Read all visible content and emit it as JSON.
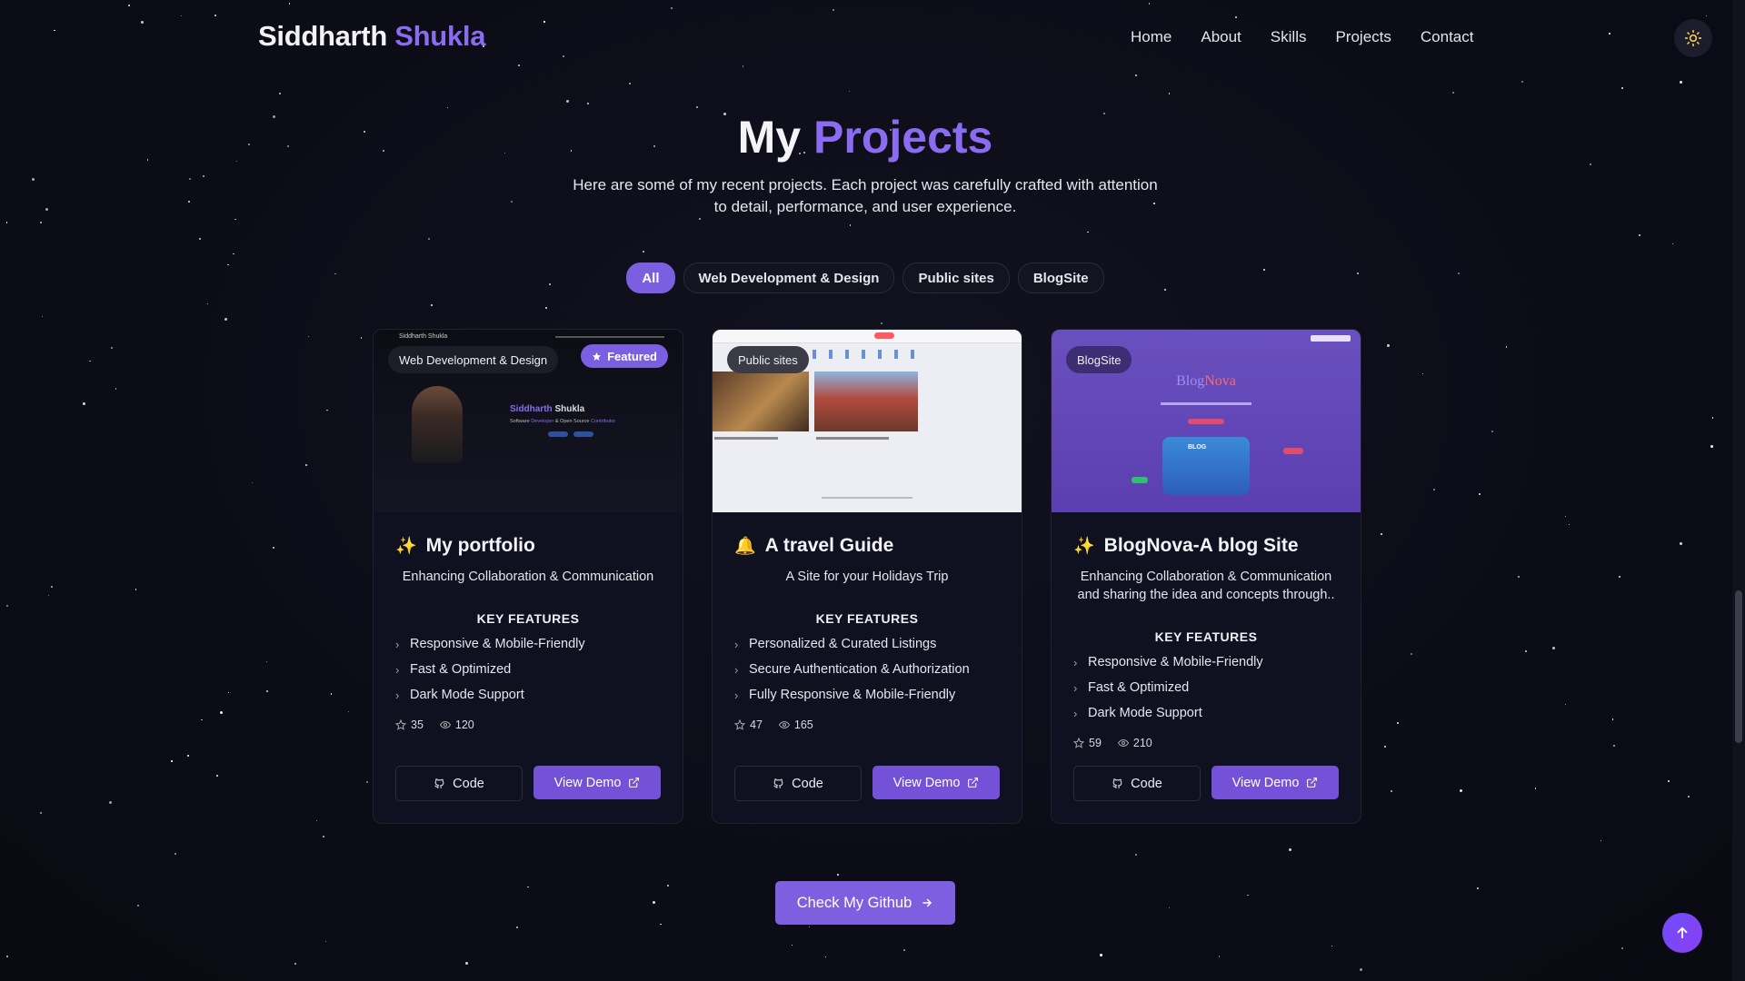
{
  "header": {
    "brand_first": "Siddharth",
    "brand_second": "Shukla",
    "nav": [
      "Home",
      "About",
      "Skills",
      "Projects",
      "Contact"
    ],
    "theme_icon": "sun-icon"
  },
  "section": {
    "title_first": "My",
    "title_second": "Projects",
    "subtitle": "Here are some of my recent projects. Each project was carefully crafted with attention to detail, performance, and user experience."
  },
  "filters": [
    "All",
    "Web Development & Design",
    "Public sites",
    "BlogSite"
  ],
  "active_filter": "All",
  "cards": [
    {
      "category": "Web Development & Design",
      "featured_label": "Featured",
      "emoji": "✨",
      "title": "My portfolio",
      "description": "Enhancing Collaboration & Communication",
      "key_features_label": "KEY FEATURES",
      "features": [
        "Responsive & Mobile-Friendly",
        "Fast & Optimized",
        "Dark Mode Support"
      ],
      "stars": "35",
      "views": "120",
      "code_label": "Code",
      "demo_label": "View Demo",
      "preview": {
        "nav_name": "Siddharth Shukla",
        "hero_first": "Siddharth",
        "hero_second": "Shukla",
        "tagline_start": "Software",
        "tagline_dev": "Developer",
        "tagline_mid": "& Open Source",
        "tagline_end": "Contributor"
      }
    },
    {
      "category": "Public sites",
      "emoji": "🔔",
      "title": "A travel Guide",
      "description": "A Site for your Holidays Trip",
      "key_features_label": "KEY FEATURES",
      "features": [
        "Personalized & Curated Listings",
        "Secure Authentication & Authorization",
        "Fully Responsive & Mobile-Friendly"
      ],
      "stars": "47",
      "views": "165",
      "code_label": "Code",
      "demo_label": "View Demo"
    },
    {
      "category": "BlogSite",
      "emoji": "✨",
      "title": "BlogNova-A blog Site",
      "description": "Enhancing Collaboration & Communication and sharing the idea and concepts through..",
      "key_features_label": "KEY FEATURES",
      "features": [
        "Responsive & Mobile-Friendly",
        "Fast & Optimized",
        "Dark Mode Support"
      ],
      "stars": "59",
      "views": "210",
      "code_label": "Code",
      "demo_label": "View Demo",
      "preview": {
        "logo_first": "Blog",
        "logo_second": "Nova",
        "tag": "BLOG"
      }
    }
  ],
  "github_button": "Check My Github",
  "colors": {
    "accent": "#8b6cf0",
    "button": "#7452d8",
    "background": "#0b0c16"
  }
}
